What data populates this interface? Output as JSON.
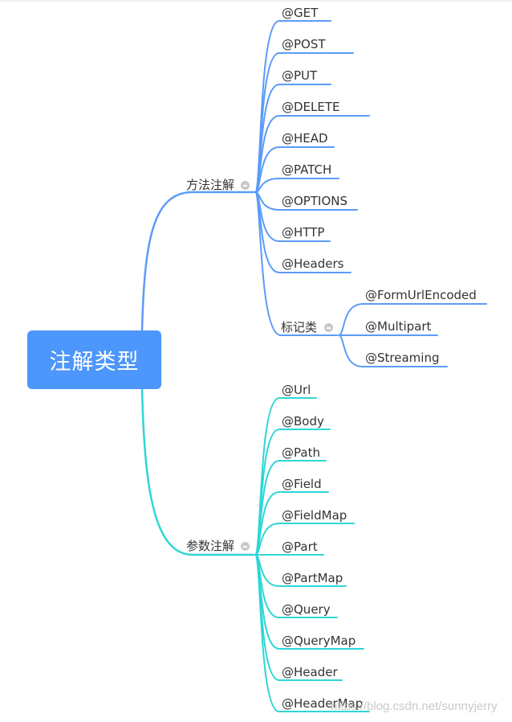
{
  "root": {
    "label": "注解类型",
    "color": "#4d96fb"
  },
  "branches": [
    {
      "label": "方法注解",
      "color": "#5b9bf8",
      "children": [
        {
          "label": "@GET"
        },
        {
          "label": "@POST"
        },
        {
          "label": "@PUT"
        },
        {
          "label": "@DELETE"
        },
        {
          "label": "@HEAD"
        },
        {
          "label": "@PATCH"
        },
        {
          "label": "@OPTIONS"
        },
        {
          "label": "@HTTP"
        },
        {
          "label": "@Headers"
        },
        {
          "label": "标记类",
          "children": [
            {
              "label": "@FormUrlEncoded"
            },
            {
              "label": "@Multipart"
            },
            {
              "label": "@Streaming"
            }
          ]
        }
      ]
    },
    {
      "label": "参数注解",
      "color": "#2fd6d6",
      "children": [
        {
          "label": "@Url"
        },
        {
          "label": "@Body"
        },
        {
          "label": "@Path"
        },
        {
          "label": "@Field"
        },
        {
          "label": "@FieldMap"
        },
        {
          "label": "@Part"
        },
        {
          "label": "@PartMap"
        },
        {
          "label": "@Query"
        },
        {
          "label": "@QueryMap"
        },
        {
          "label": "@Header"
        },
        {
          "label": "@HeaderMap"
        }
      ]
    }
  ],
  "watermark": "https://blog.csdn.net/sunnyjerry"
}
